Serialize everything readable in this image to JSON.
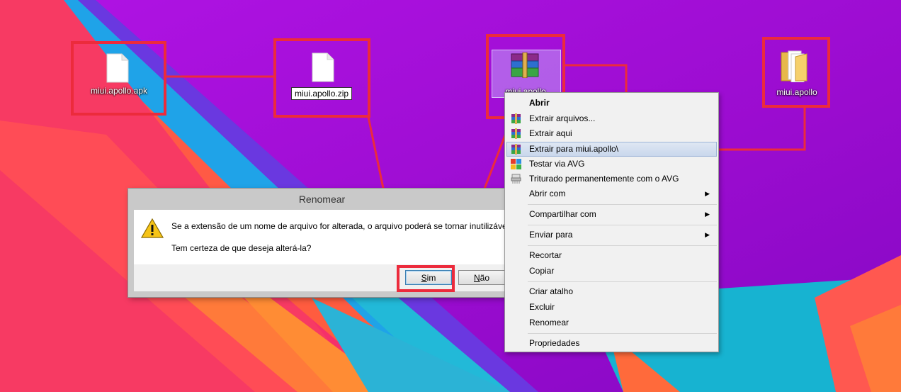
{
  "desktop": {
    "icons": [
      {
        "label": "miui.apollo.apk",
        "icon": "file-icon"
      },
      {
        "label": "miui.apollo.zip",
        "icon": "file-icon"
      },
      {
        "label": "miui.apollo",
        "icon": "winrar-archive-icon"
      },
      {
        "label": "miui.apollo",
        "icon": "folder-icon"
      }
    ]
  },
  "dialog": {
    "title": "Renomear",
    "message": "Se a extensão de um nome de arquivo for alterada, o arquivo poderá se tornar inutilizável.",
    "question": "Tem certeza de que deseja alterá-la?",
    "yes_prefix": "",
    "yes_underline": "S",
    "yes_rest": "im",
    "no_prefix": "",
    "no_underline": "N",
    "no_rest": "ão",
    "icon": "warning-icon"
  },
  "context_menu": {
    "items": [
      {
        "label": "Abrir",
        "bold": true
      },
      {
        "label": "Extrair arquivos...",
        "icon": "winrar-icon"
      },
      {
        "label": "Extrair aqui",
        "icon": "winrar-icon"
      },
      {
        "label": "Extrair para miui.apollo\\",
        "icon": "winrar-icon",
        "highlighted": true
      },
      {
        "label": "Testar via  AVG",
        "icon": "avg-icon"
      },
      {
        "label": "Triturado permanentemente com o AVG",
        "icon": "shredder-icon"
      },
      {
        "label": "Abrir com",
        "submenu": true
      },
      {
        "label": "Compartilhar com",
        "submenu": true
      },
      {
        "label": "Enviar para",
        "submenu": true
      },
      {
        "label": "Recortar"
      },
      {
        "label": "Copiar"
      },
      {
        "label": "Criar atalho"
      },
      {
        "label": "Excluir"
      },
      {
        "label": "Renomear"
      },
      {
        "label": "Propriedades"
      }
    ]
  },
  "colors": {
    "annotation_red": "#ec2b3c",
    "desktop_purple": "#a010d8"
  }
}
